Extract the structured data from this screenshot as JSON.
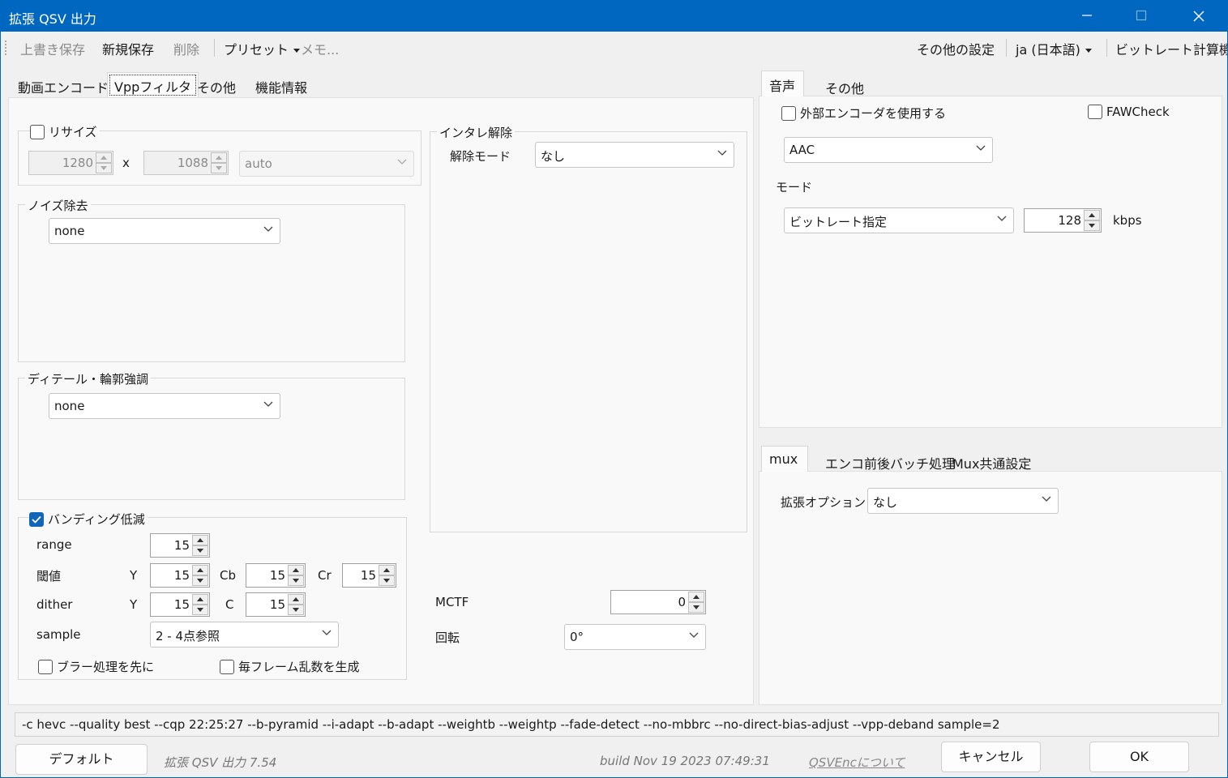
{
  "window": {
    "title": "拡張 QSV 出力"
  },
  "toolbar": {
    "overwrite_save": "上書き保存",
    "new_save": "新規保存",
    "delete": "削除",
    "preset": "プリセット",
    "memo": "メモ...",
    "other_settings": "その他の設定",
    "language": "ja (日本語)",
    "bitrate_calc": "ビットレート計算機"
  },
  "left_tabs": [
    "動画エンコード",
    "Vppフィルタ",
    "その他",
    "機能情報"
  ],
  "vpp": {
    "resize": {
      "label": "リサイズ",
      "checked": false,
      "width": "1280",
      "x": "x",
      "height": "1088",
      "mode": "auto"
    },
    "noise": {
      "label": "ノイズ除去",
      "value": "none"
    },
    "detail": {
      "label": "ディテール・輪郭強調",
      "value": "none"
    },
    "deband": {
      "label": "バンディング低減",
      "checked": true,
      "range_label": "range",
      "range": "15",
      "threshold_label": "閾値",
      "y_label": "Y",
      "y": "15",
      "cb_label": "Cb",
      "cb": "15",
      "cr_label": "Cr",
      "cr": "15",
      "dither_label": "dither",
      "dither_y_label": "Y",
      "dither_y": "15",
      "dither_c_label": "C",
      "dither_c": "15",
      "sample_label": "sample",
      "sample": "2 - 4点参照",
      "blur_first": "ブラー処理を先に",
      "rand_each_frame": "毎フレーム乱数を生成"
    },
    "deinterlace": {
      "label": "インタレ解除",
      "mode_label": "解除モード",
      "mode": "なし"
    },
    "mctf": {
      "label": "MCTF",
      "value": "0"
    },
    "rotate": {
      "label": "回転",
      "value": "0°"
    }
  },
  "audio_tabs": [
    "音声",
    "その他"
  ],
  "audio": {
    "use_external": "外部エンコーダを使用する",
    "faw_check": "FAWCheck",
    "encoder": "AAC",
    "mode_label": "モード",
    "mode": "ビットレート指定",
    "bitrate": "128",
    "unit": "kbps"
  },
  "mux_tabs": [
    "mux",
    "エンコ前後バッチ処理",
    "Mux共通設定"
  ],
  "mux": {
    "ext_option_label": "拡張オプション",
    "ext_option": "なし"
  },
  "command_line": "-c hevc --quality best --cqp 22:25:27 --b-pyramid --i-adapt --b-adapt --weightb --weightp --fade-detect --no-mbbrc --no-direct-bias-adjust --vpp-deband sample=2",
  "footer": {
    "default_button": "デフォルト",
    "version": "拡張 QSV 出力 7.54",
    "build": "build Nov 19 2023 07:49:31",
    "about": "QSVEncについて",
    "cancel_button": "キャンセル",
    "ok_button": "OK"
  }
}
